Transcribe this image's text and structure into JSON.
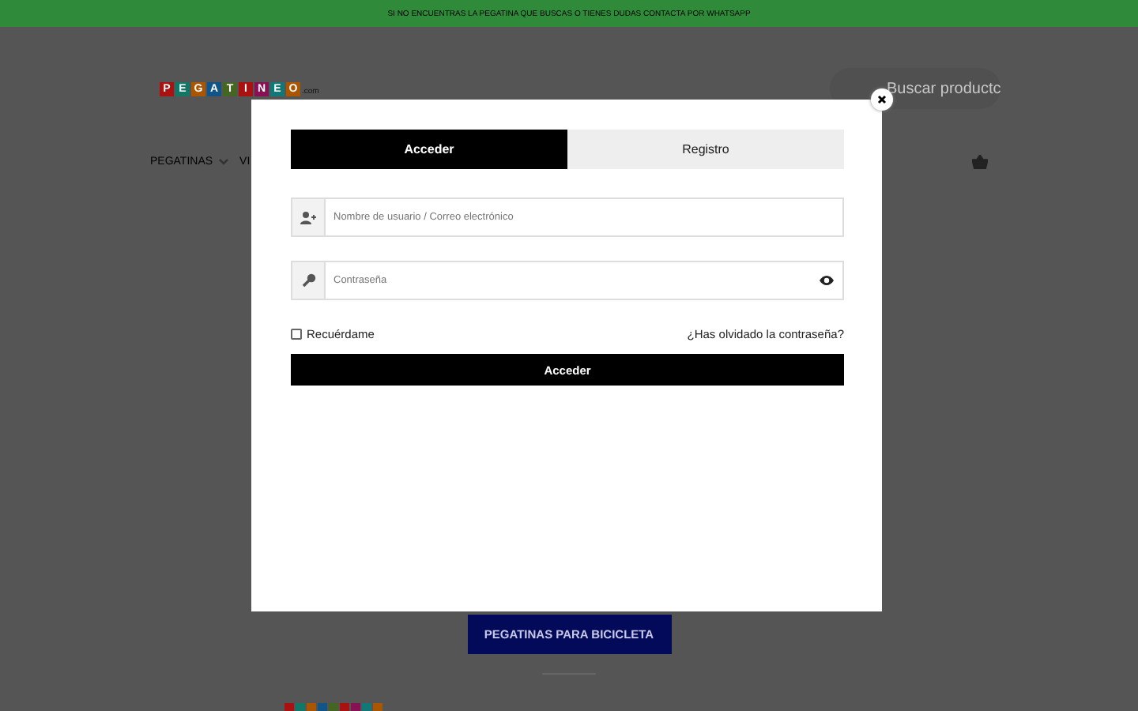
{
  "banner": {
    "text": "SI NO ENCUENTRAS LA PEGATINA QUE BUSCAS O TIENES DUDAS CONTACTA POR WHATSAPP"
  },
  "logo": {
    "letters": [
      "P",
      "E",
      "G",
      "A",
      "T",
      "I",
      "N",
      "E",
      "O"
    ],
    "suffix": ".com"
  },
  "search": {
    "placeholder": "Buscar productc"
  },
  "nav": [
    {
      "label": "PEGATINAS",
      "dropdown": true
    },
    {
      "label": "VI",
      "dropdown": false
    }
  ],
  "category_button": "PEGATINAS PARA BICICLETA",
  "modal": {
    "tabs": [
      {
        "label": "Acceder",
        "selected": true
      },
      {
        "label": "Registro",
        "selected": false
      }
    ],
    "username": {
      "placeholder": "Nombre de usuario / Correo electrónico"
    },
    "password": {
      "placeholder": "Contraseña"
    },
    "remember": {
      "label": "Recuérdame",
      "checked": false
    },
    "forgot": "¿Has olvidado la contraseña?",
    "submit": "Acceder"
  }
}
